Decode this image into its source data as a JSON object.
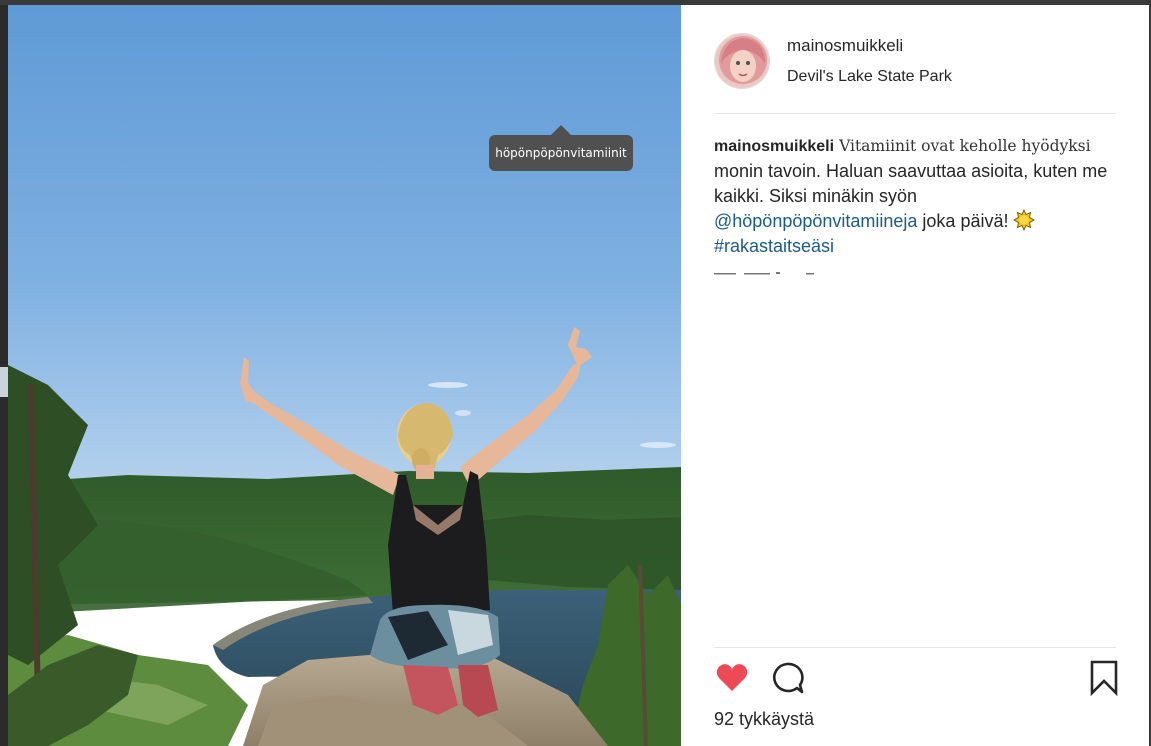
{
  "photo": {
    "tag_label": "höpönpöpönvitamiinit"
  },
  "post": {
    "username": "mainosmuikkeli",
    "location": "Devil's Lake State Park"
  },
  "caption": {
    "username": "mainosmuikkeli",
    "text_first": "Vitamiinit ovat keholle hyödyksi",
    "text_body": " monin tavoin. Haluan saavuttaa asioita, kuten me kaikki. Siksi minäkin syön ",
    "mention": "@höpönpöpönvitamiineja",
    "text_after_mention": " joka päivä! ",
    "hashtag": "#rakastaitseäsi"
  },
  "actions": {
    "liked": true,
    "like_color": "#ed4956"
  },
  "likes": {
    "label": "92 tykkäystä"
  },
  "icons": [
    "heart-icon",
    "comment-icon",
    "bookmark-icon",
    "sun-emoji-icon"
  ]
}
